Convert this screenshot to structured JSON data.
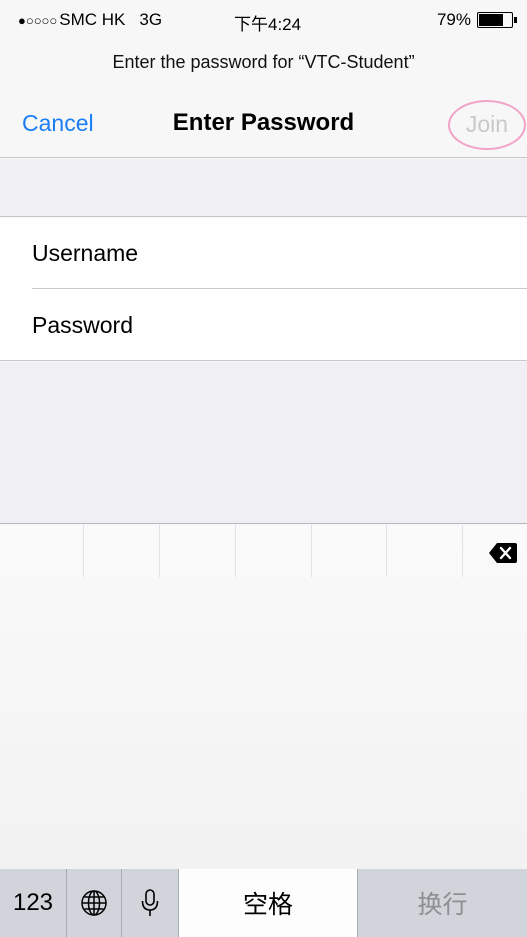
{
  "status_bar": {
    "signal": "●○○○○",
    "carrier": "SMC HK",
    "network": "3G",
    "time": "下午4:24",
    "battery_text": "79%",
    "battery_level": 0.79
  },
  "prompt": "Enter the password for “VTC-Student”",
  "nav": {
    "cancel_label": "Cancel",
    "title": "Enter Password",
    "join_label": "Join"
  },
  "form": {
    "username_placeholder": "Username",
    "password_placeholder": "Password"
  },
  "keyboard": {
    "numbers_label": "123",
    "space_label": "空格",
    "return_label": "换行",
    "icons": [
      "globe-icon",
      "microphone-icon",
      "backspace-icon"
    ]
  },
  "colors": {
    "accent": "#1a7ef5",
    "join_disabled": "#c9c9cc",
    "annotation_circle": "#f2a3c8"
  }
}
